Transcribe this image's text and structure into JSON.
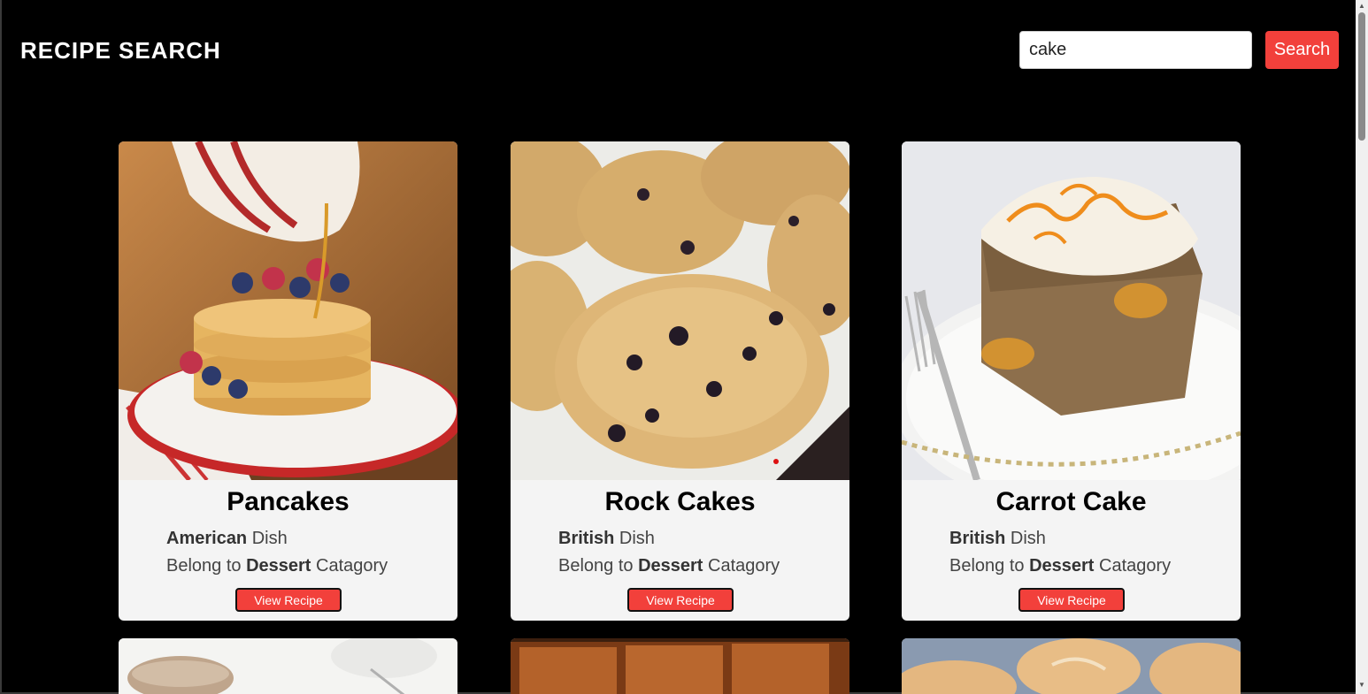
{
  "header": {
    "title": "RECIPE SEARCH",
    "search_value": "cake",
    "search_button": "Search"
  },
  "cards": [
    {
      "title": "Pancakes",
      "area": "American",
      "area_suffix": "Dish",
      "category_prefix": "Belong to",
      "category": "Dessert",
      "category_suffix": "Catagory",
      "button": "View Recipe"
    },
    {
      "title": "Rock Cakes",
      "area": "British",
      "area_suffix": "Dish",
      "category_prefix": "Belong to",
      "category": "Dessert",
      "category_suffix": "Catagory",
      "button": "View Recipe"
    },
    {
      "title": "Carrot Cake",
      "area": "British",
      "area_suffix": "Dish",
      "category_prefix": "Belong to",
      "category": "Dessert",
      "category_suffix": "Catagory",
      "button": "View Recipe"
    }
  ],
  "colors": {
    "accent": "#f2403b",
    "background": "#000000",
    "card": "#f4f4f4"
  }
}
